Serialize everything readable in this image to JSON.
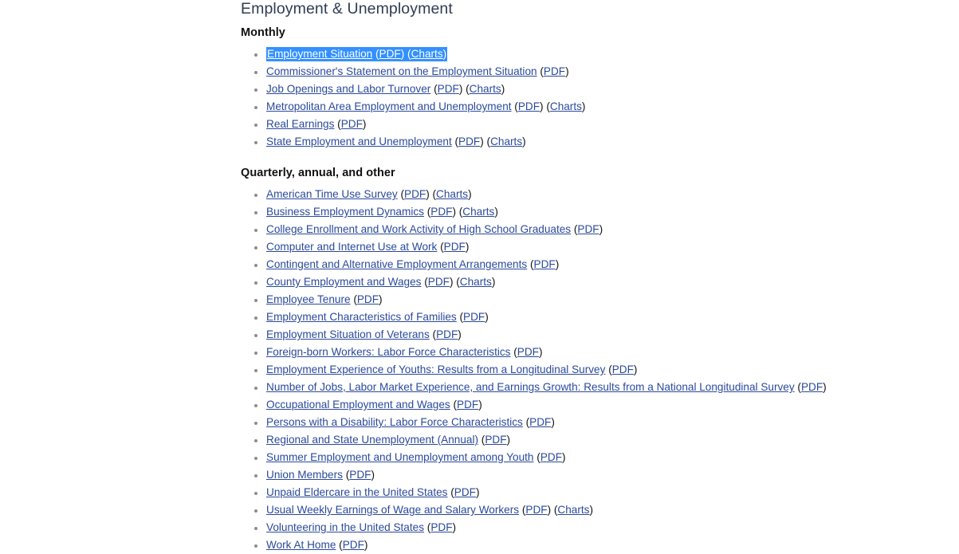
{
  "page": {
    "title": "Employment & Unemployment",
    "background_color": "#ffffff",
    "title_color": "#2f3d53",
    "link_color": "#2b4a9b",
    "selection_color": "#3390ff",
    "selection_text_color": "#ffffff",
    "bullet_color": "#8c8c8c"
  },
  "sections": [
    {
      "heading": "Monthly",
      "items": [
        {
          "label": "Employment Situation",
          "selected": true,
          "links": [
            "PDF",
            "Charts"
          ]
        },
        {
          "label": "Commissioner's Statement on the Employment Situation",
          "selected": false,
          "links": [
            "PDF"
          ]
        },
        {
          "label": "Job Openings and Labor Turnover",
          "selected": false,
          "links": [
            "PDF",
            "Charts"
          ]
        },
        {
          "label": "Metropolitan Area Employment and Unemployment",
          "selected": false,
          "links": [
            "PDF",
            "Charts"
          ]
        },
        {
          "label": "Real Earnings",
          "selected": false,
          "links": [
            "PDF"
          ]
        },
        {
          "label": "State Employment and Unemployment",
          "selected": false,
          "links": [
            "PDF",
            "Charts"
          ]
        }
      ]
    },
    {
      "heading": "Quarterly, annual, and other",
      "items": [
        {
          "label": "American Time Use Survey",
          "selected": false,
          "links": [
            "PDF",
            "Charts"
          ]
        },
        {
          "label": "Business Employment Dynamics",
          "selected": false,
          "links": [
            "PDF",
            "Charts"
          ]
        },
        {
          "label": "College Enrollment and Work Activity of High School Graduates",
          "selected": false,
          "links": [
            "PDF"
          ]
        },
        {
          "label": "Computer and Internet Use at Work",
          "selected": false,
          "links": [
            "PDF"
          ]
        },
        {
          "label": "Contingent and Alternative Employment Arrangements",
          "selected": false,
          "links": [
            "PDF"
          ]
        },
        {
          "label": "County Employment and Wages",
          "selected": false,
          "links": [
            "PDF",
            "Charts"
          ]
        },
        {
          "label": "Employee Tenure",
          "selected": false,
          "links": [
            "PDF"
          ]
        },
        {
          "label": "Employment Characteristics of Families",
          "selected": false,
          "links": [
            "PDF"
          ]
        },
        {
          "label": "Employment Situation of Veterans",
          "selected": false,
          "links": [
            "PDF"
          ]
        },
        {
          "label": "Foreign-born Workers: Labor Force Characteristics",
          "selected": false,
          "links": [
            "PDF"
          ]
        },
        {
          "label": "Employment Experience of Youths: Results from a Longitudinal Survey",
          "selected": false,
          "links": [
            "PDF"
          ]
        },
        {
          "label": "Number of Jobs, Labor Market Experience, and Earnings Growth: Results from a National Longitudinal Survey",
          "selected": false,
          "links": [
            "PDF"
          ]
        },
        {
          "label": "Occupational Employment and Wages",
          "selected": false,
          "links": [
            "PDF"
          ]
        },
        {
          "label": "Persons with a Disability: Labor Force Characteristics",
          "selected": false,
          "links": [
            "PDF"
          ]
        },
        {
          "label": "Regional and State Unemployment (Annual)",
          "selected": false,
          "links": [
            "PDF"
          ]
        },
        {
          "label": "Summer Employment and Unemployment among Youth",
          "selected": false,
          "links": [
            "PDF"
          ]
        },
        {
          "label": "Union Members",
          "selected": false,
          "links": [
            "PDF"
          ]
        },
        {
          "label": "Unpaid Eldercare in the United States",
          "selected": false,
          "links": [
            "PDF"
          ]
        },
        {
          "label": "Usual Weekly Earnings of Wage and Salary Workers",
          "selected": false,
          "links": [
            "PDF",
            "Charts"
          ]
        },
        {
          "label": "Volunteering in the United States",
          "selected": false,
          "links": [
            "PDF"
          ]
        },
        {
          "label": "Work At Home",
          "selected": false,
          "links": [
            "PDF"
          ]
        }
      ]
    }
  ]
}
